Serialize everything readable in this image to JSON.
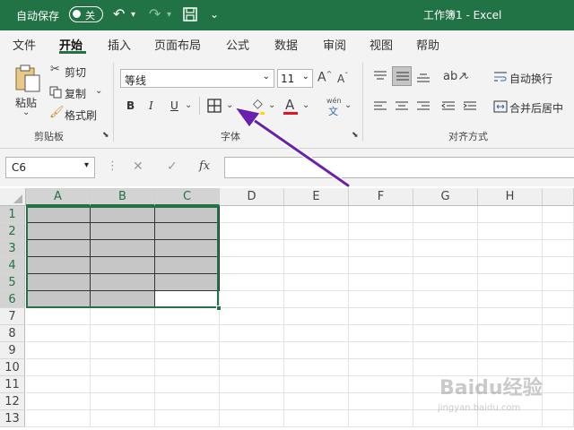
{
  "titlebar": {
    "autosave_label": "自动保存",
    "toggle_text": "关",
    "title": "工作簿1  -  Excel"
  },
  "tabs": [
    "文件",
    "开始",
    "插入",
    "页面布局",
    "公式",
    "数据",
    "审阅",
    "视图",
    "帮助"
  ],
  "ribbon": {
    "paste": "粘贴",
    "cut": "剪切",
    "copy": "复制",
    "format_painter": "格式刷",
    "clipboard_group": "剪贴板",
    "font_name": "等线",
    "font_size": "11",
    "bold": "B",
    "italic": "I",
    "underline": "U",
    "font_group": "字体",
    "wen_label": "wén",
    "wrap_text": "自动换行",
    "merge_center": "合并后居中",
    "align_group": "对齐方式"
  },
  "formula_bar": {
    "name_box": "C6",
    "fx": "fx",
    "formula": ""
  },
  "grid": {
    "columns": [
      "A",
      "B",
      "C",
      "D",
      "E",
      "F",
      "G",
      "H"
    ],
    "rows": [
      "1",
      "2",
      "3",
      "4",
      "5",
      "6",
      "7",
      "8",
      "9",
      "10",
      "11",
      "12",
      "13"
    ],
    "active_cell": "C6"
  },
  "watermark": {
    "text": "Baidu经验",
    "sub": "jingyan.baidu.com"
  },
  "colors": {
    "accent": "#217346",
    "selection_fill": "#c6c6c6",
    "arrow": "#6a1fb0",
    "font_color_bar": "#e81123"
  }
}
